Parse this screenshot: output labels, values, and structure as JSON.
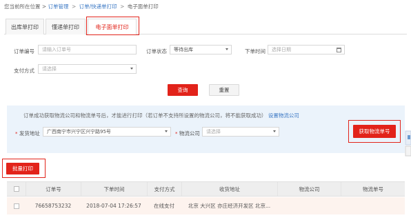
{
  "breadcrumb": {
    "prefix": "您当前所在位置 >",
    "item1": "订单管理",
    "sep1": ">",
    "item2": "订单/快递单打印",
    "sep2": ">",
    "current": "电子面单打印"
  },
  "tabs": [
    "出库单打印",
    "懂递单打印",
    "电子面单打印"
  ],
  "filters": {
    "order_no_label": "订单编号",
    "order_no_placeholder": "请输入订单号",
    "status_label": "订单状态",
    "status_value": "等待出库",
    "time_label": "下单时间",
    "time_placeholder": "选择日期",
    "pay_label": "支付方式",
    "pay_placeholder": "请选择"
  },
  "buttons": {
    "query": "查询",
    "reset": "重置",
    "get_tracking": "获取物流单号",
    "batch_print": "批量打印"
  },
  "notice": {
    "text": "订单成功获取物流公司和物流单号后，才能进行打印（若订单不支持所设置的物流公司，将不能获取成功）",
    "link": "设置物流公司",
    "ship_addr_label": "发货地址",
    "ship_addr_value": "广西南宁市兴宁区兴宁路95号",
    "logistics_label": "物流公司",
    "logistics_placeholder": "请选择",
    "req1": "*",
    "req2": "*"
  },
  "table": {
    "headers": [
      "订单号",
      "下单时间",
      "支付方式",
      "收货地址",
      "物流公司",
      "物流单号"
    ],
    "rows": [
      {
        "order_no": "76658753232",
        "time": "2018-07-04 17:26:57",
        "pay": "在线支付",
        "address": "北京 大兴区 亦庄经济开发区 北京...",
        "company": "",
        "tracking": ""
      }
    ]
  },
  "colors": {
    "accent": "#e2231a",
    "link": "#3b78c4",
    "notice_bg": "#ebf3fb",
    "row_bg": "#fdf3ee"
  }
}
